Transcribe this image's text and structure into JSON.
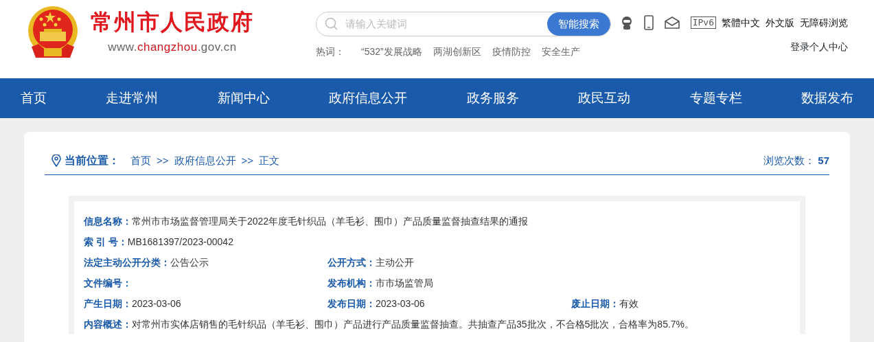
{
  "header": {
    "site_title": "常州市人民政府",
    "site_url": [
      {
        "text": "www.",
        "highlight": false
      },
      {
        "text": "changzhou",
        "highlight": true
      },
      {
        "text": ".gov.cn",
        "highlight": false
      }
    ],
    "search": {
      "placeholder": "请输入关键词",
      "button": "智能搜索"
    },
    "hot_label": "热词：",
    "hot_words": [
      "“532”发展战略",
      "两湖创新区",
      "疫情防控",
      "安全生产"
    ],
    "ipv6": "IPv6",
    "tool_links": [
      "繁體中文",
      "外文版",
      "无障碍浏览"
    ],
    "login": "登录个人中心"
  },
  "nav": [
    "首页",
    "走进常州",
    "新闻中心",
    "政府信息公开",
    "政务服务",
    "政民互动",
    "专题专栏",
    "数据发布"
  ],
  "breadcrumb": {
    "label": "当前位置：",
    "items": [
      "首页",
      "政府信息公开",
      "正文"
    ],
    "separator": ">>"
  },
  "views": {
    "label": "浏览次数：",
    "count": "57"
  },
  "info": [
    [
      {
        "label": "信息名称：",
        "value": "常州市市场监督管理局关于2022年度毛针织品（羊毛衫、围巾）产品质量监督抽查结果的通报"
      }
    ],
    [
      {
        "label": "索 引 号：",
        "value": "MB1681397/2023-00042"
      }
    ],
    [
      {
        "label": "法定主动公开分类：",
        "value": "公告公示"
      },
      {
        "label": "公开方式：",
        "value": "主动公开"
      }
    ],
    [
      {
        "label": "文件编号："
      },
      {
        "label": "发布机构：",
        "value": "市市场监管局"
      }
    ],
    [
      {
        "label": "产生日期：",
        "value": "2023-03-06"
      },
      {
        "label": "发布日期：",
        "value": "2023-03-06"
      },
      {
        "label": "废止日期：",
        "value": "有效"
      }
    ],
    [
      {
        "label": "内容概述：",
        "value": "对常州市实体店销售的毛针织品（羊毛衫、围巾）产品进行产品质量监督抽查。共抽查产品35批次，不合格5批次，合格率为85.7%。"
      }
    ]
  ]
}
